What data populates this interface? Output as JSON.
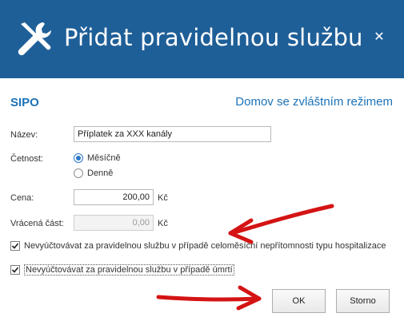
{
  "window": {
    "title": "Přidat pravidelnou službu",
    "title_icon": "tools-icon",
    "close_icon": "close-icon",
    "close_symbol": "✕",
    "titlebar_color": "#1f5f98"
  },
  "subheader": {
    "left": "SIPO",
    "right": "Domov se zvláštním režimem",
    "color": "#1c73b8"
  },
  "form": {
    "name_label": "Název:",
    "name_value": "Příplatek za XXX kanály",
    "frequency_label": "Četnost:",
    "frequency_options": [
      {
        "label": "Měsíčně",
        "checked": true
      },
      {
        "label": "Denně",
        "checked": false
      }
    ],
    "price_label": "Cena:",
    "price_value": "200,00",
    "price_unit": "Kč",
    "refund_label": "Vrácená část:",
    "refund_value": "0,00",
    "refund_unit": "Kč",
    "checkbox_hospital": {
      "label": "Nevyúčtovávat za pravidelnou službu v případě celoměsíční nepřítomnosti typu hospitalizace",
      "checked": true
    },
    "checkbox_death": {
      "label": "Nevyúčtovávat za pravidelnou službu v případě úmrtí",
      "checked": true
    }
  },
  "buttons": {
    "ok": "OK",
    "cancel": "Storno"
  },
  "annotations": {
    "arrow_color": "#d41414"
  }
}
